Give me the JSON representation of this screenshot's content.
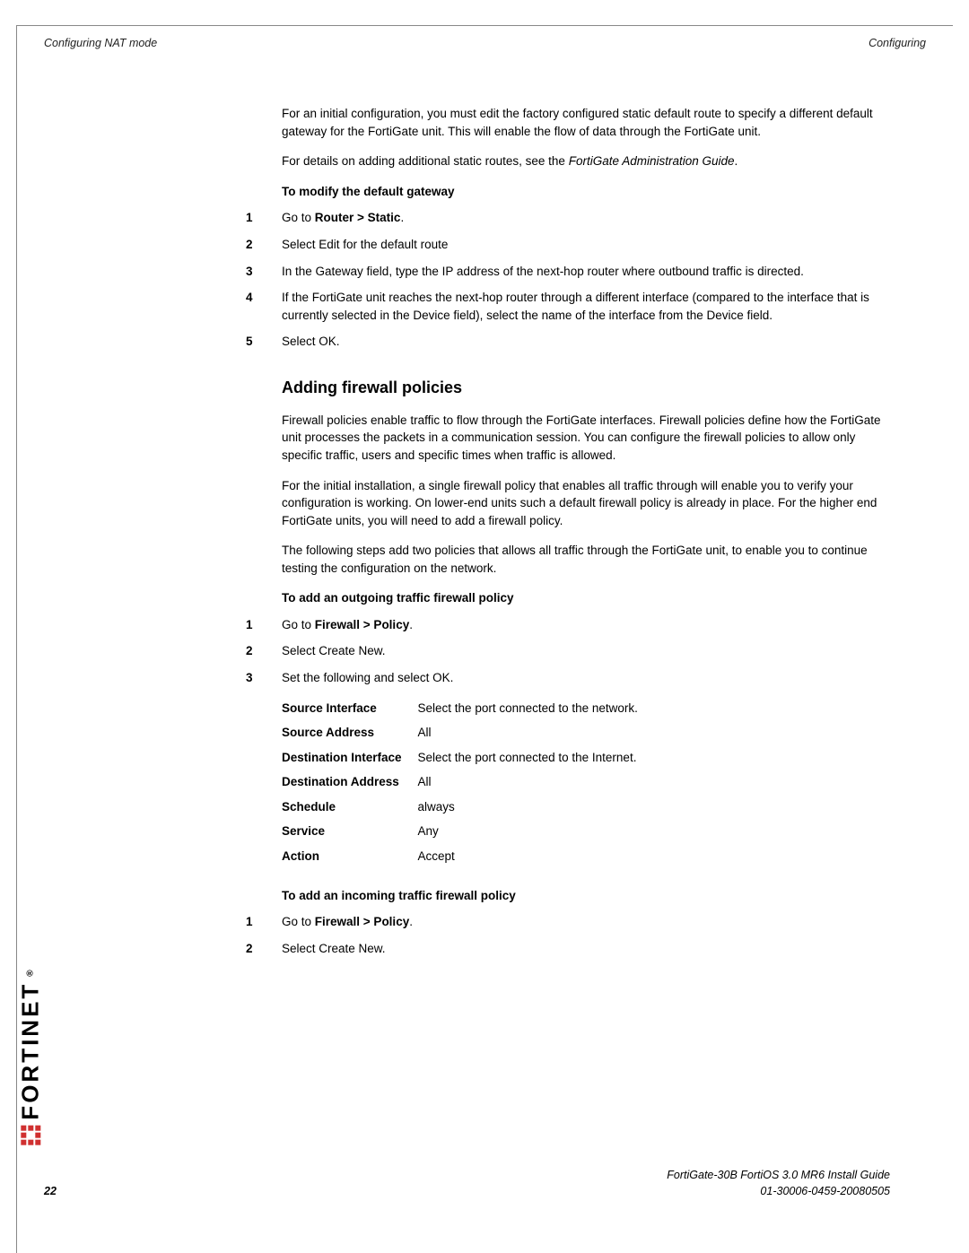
{
  "header": {
    "left": "Configuring NAT mode",
    "right": "Configuring"
  },
  "intro": {
    "p1_a": "For an initial configuration, you must edit the factory configured static default route to specify a different default gateway for the FortiGate unit. This will enable the flow of data through the FortiGate unit.",
    "p2_a": "For details on adding additional static routes, see the ",
    "p2_em": "FortiGate Administration Guide",
    "p2_b": "."
  },
  "proc1": {
    "title": "To modify the default gateway",
    "s1_a": "Go to ",
    "s1_b": "Router > Static",
    "s1_c": ".",
    "s2": "Select Edit for the default route",
    "s3": "In the Gateway field, type the IP address of the next-hop router where outbound traffic is directed.",
    "s4": "If the FortiGate unit reaches the next-hop router through a different interface (compared to the interface that is currently selected in the Device field), select the name of the interface from the Device field.",
    "s5": "Select OK."
  },
  "section": {
    "title": "Adding firewall policies",
    "p1": "Firewall policies enable traffic to flow through the FortiGate interfaces. Firewall policies define how the FortiGate unit processes the packets in a communication session. You can configure the firewall policies to allow only specific traffic, users and specific times when traffic is allowed.",
    "p2": "For the initial installation, a single firewall policy that enables all traffic through will enable you to verify your configuration is working. On lower-end units such a default firewall policy is already in place. For the higher end FortiGate units, you will need to add a firewall policy.",
    "p3": "The following steps add two policies that allows all traffic through the FortiGate unit, to enable you to continue testing the configuration on the network."
  },
  "proc2": {
    "title": "To add an outgoing traffic firewall policy",
    "s1_a": "Go to ",
    "s1_b": "Firewall > Policy",
    "s1_c": ".",
    "s2": "Select Create New.",
    "s3": "Set the following and select OK."
  },
  "table": {
    "r1l": "Source Interface",
    "r1v": "Select the port connected to the network.",
    "r2l": "Source Address",
    "r2v": "All",
    "r3l": "Destination Interface",
    "r3v": "Select the port connected to the Internet.",
    "r4l": "Destination Address",
    "r4v": "All",
    "r5l": "Schedule",
    "r5v": "always",
    "r6l": "Service",
    "r6v": "Any",
    "r7l": "Action",
    "r7v": "Accept"
  },
  "proc3": {
    "title": "To add an incoming traffic firewall policy",
    "s1_a": "Go to ",
    "s1_b": "Firewall > Policy",
    "s1_c": ".",
    "s2": "Select Create New."
  },
  "logo": {
    "text": "FORTINET",
    "trademark": "®"
  },
  "footer": {
    "page": "22",
    "line1": "FortiGate-30B FortiOS 3.0 MR6 Install Guide",
    "line2": "01-30006-0459-20080505"
  },
  "nums": {
    "n1": "1",
    "n2": "2",
    "n3": "3",
    "n4": "4",
    "n5": "5"
  }
}
